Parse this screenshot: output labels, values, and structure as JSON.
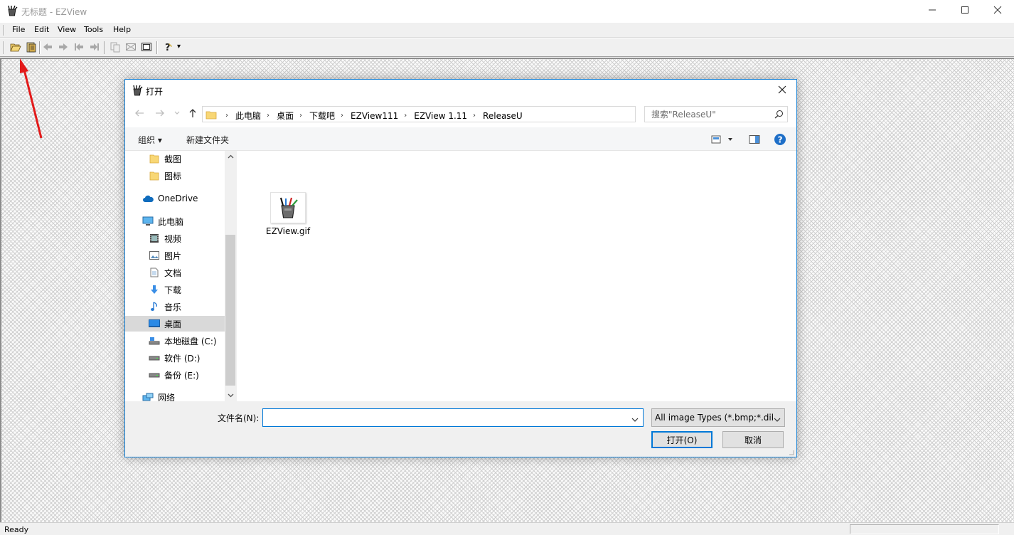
{
  "window": {
    "title": "无标题 - EZView",
    "menu": [
      "File",
      "Edit",
      "View",
      "Tools",
      "Help"
    ],
    "status": "Ready",
    "controls": {
      "minimize": "minimize-icon",
      "maximize": "maximize-icon",
      "close": "close-icon"
    }
  },
  "toolbar": {
    "icons": [
      "open-folder-icon",
      "browse-icon",
      "back-arrow-icon",
      "forward-arrow-icon",
      "first-icon",
      "last-icon",
      "copy-icon",
      "envelope-icon",
      "fullscreen-icon",
      "help-icon"
    ],
    "help_dropdown": "▾"
  },
  "dialog": {
    "title": "打开",
    "breadcrumb": [
      "此电脑",
      "桌面",
      "下载吧",
      "EZView111",
      "EZView 1.11",
      "ReleaseU"
    ],
    "search_placeholder": "搜索\"ReleaseU\"",
    "organize_label": "组织 ▾",
    "new_folder_label": "新建文件夹",
    "nav_items": [
      {
        "label": "截图",
        "icon": "folder-icon"
      },
      {
        "label": "图标",
        "icon": "folder-icon"
      },
      {
        "label": "OneDrive",
        "icon": "cloud-icon"
      },
      {
        "label": "此电脑",
        "icon": "computer-icon"
      },
      {
        "label": "视频",
        "icon": "video-icon"
      },
      {
        "label": "图片",
        "icon": "pictures-icon"
      },
      {
        "label": "文档",
        "icon": "document-icon"
      },
      {
        "label": "下载",
        "icon": "download-icon"
      },
      {
        "label": "音乐",
        "icon": "music-icon"
      },
      {
        "label": "桌面",
        "icon": "desktop-icon",
        "selected": true
      },
      {
        "label": "本地磁盘 (C:)",
        "icon": "drive-icon"
      },
      {
        "label": "软件 (D:)",
        "icon": "drive-icon"
      },
      {
        "label": "备份 (E:)",
        "icon": "drive-icon"
      },
      {
        "label": "网络",
        "icon": "network-icon"
      }
    ],
    "files": [
      {
        "name": "EZView.gif",
        "icon": "ezview-file-icon"
      }
    ],
    "filename_label": "文件名(N):",
    "filename_value": "",
    "filetype_value": "All image Types (*.bmp;*.dib",
    "open_label": "打开(O)",
    "cancel_label": "取消"
  },
  "colors": {
    "accent": "#0078d7",
    "annotation_arrow": "#e21a1a",
    "selected_nav": "#d9d9d9"
  }
}
